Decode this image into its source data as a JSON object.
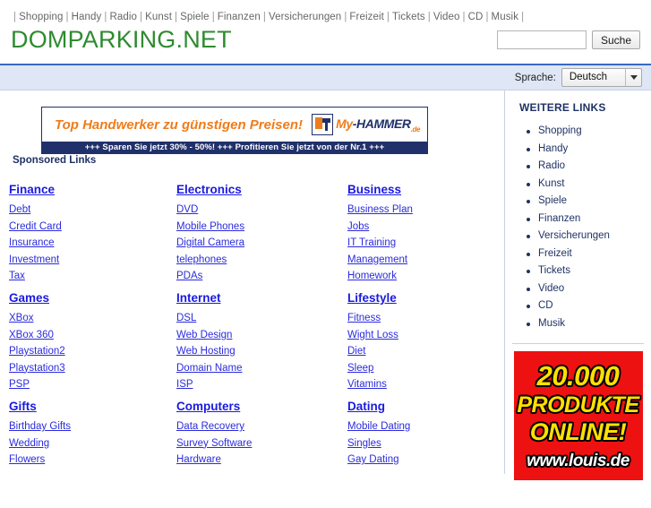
{
  "topnav": {
    "separator": "|",
    "items": [
      "Shopping",
      "Handy",
      "Radio",
      "Kunst",
      "Spiele",
      "Finanzen",
      "Versicherungen",
      "Freizeit",
      "Tickets",
      "Video",
      "CD",
      "Musik"
    ]
  },
  "header": {
    "logo": "DOMPARKING.NET",
    "search": {
      "value": "",
      "placeholder": "",
      "button_label": "Suche"
    }
  },
  "language_bar": {
    "label": "Sprache:",
    "selected": "Deutsch",
    "options": [
      "Deutsch"
    ]
  },
  "banner_ad": {
    "slogan": "Top Handwerker zu günstigen Preisen!",
    "logo_my": "My",
    "logo_hammer": "-HAMMER",
    "logo_tld": ".de",
    "strip": "+++  Sparen Sie jetzt 30% - 50%!  +++  Profitieren Sie jetzt von der Nr.1  +++"
  },
  "sponsored_label": "Sponsored Links",
  "link_groups": [
    {
      "title": "Finance",
      "links": [
        "Debt",
        "Credit Card",
        "Insurance",
        "Investment",
        "Tax"
      ]
    },
    {
      "title": "Electronics",
      "links": [
        "DVD",
        "Mobile Phones",
        "Digital Camera",
        "telephones",
        "PDAs"
      ]
    },
    {
      "title": "Business",
      "links": [
        "Business Plan",
        "Jobs",
        "IT Training",
        "Management",
        "Homework"
      ]
    },
    {
      "title": "Games",
      "links": [
        "XBox",
        "XBox 360",
        "Playstation2",
        "Playstation3",
        "PSP"
      ]
    },
    {
      "title": "Internet",
      "links": [
        "DSL",
        "Web Design",
        "Web Hosting",
        "Domain Name",
        "ISP"
      ]
    },
    {
      "title": "Lifestyle",
      "links": [
        "Fitness",
        "Wight Loss",
        "Diet",
        "Sleep",
        "Vitamins"
      ]
    },
    {
      "title": "Gifts",
      "links": [
        "Birthday Gifts",
        "Wedding",
        "Flowers"
      ]
    },
    {
      "title": "Computers",
      "links": [
        "Data Recovery",
        "Survey Software",
        "Hardware"
      ]
    },
    {
      "title": "Dating",
      "links": [
        "Mobile Dating",
        "Singles",
        "Gay Dating"
      ]
    }
  ],
  "sidebar": {
    "title": "WEITERE LINKS",
    "items": [
      "Shopping",
      "Handy",
      "Radio",
      "Kunst",
      "Spiele",
      "Finanzen",
      "Versicherungen",
      "Freizeit",
      "Tickets",
      "Video",
      "CD",
      "Musik"
    ]
  },
  "louis_ad": {
    "line1": "20.000",
    "line2": "PRODUKTE",
    "line3": "ONLINE!",
    "line4": "www.louis.de"
  },
  "colors": {
    "logo_green": "#2e8b2f",
    "link_blue": "#2b2bdd",
    "heading_blue": "#1a1ae0",
    "navy": "#1f3264",
    "langbar_bg": "#dfe6f6",
    "langbar_border": "#3b68c4",
    "banner_orange": "#ef7c1a",
    "banner_navy": "#20306a",
    "louis_red": "#ee1111",
    "louis_yellow": "#ffe000"
  }
}
